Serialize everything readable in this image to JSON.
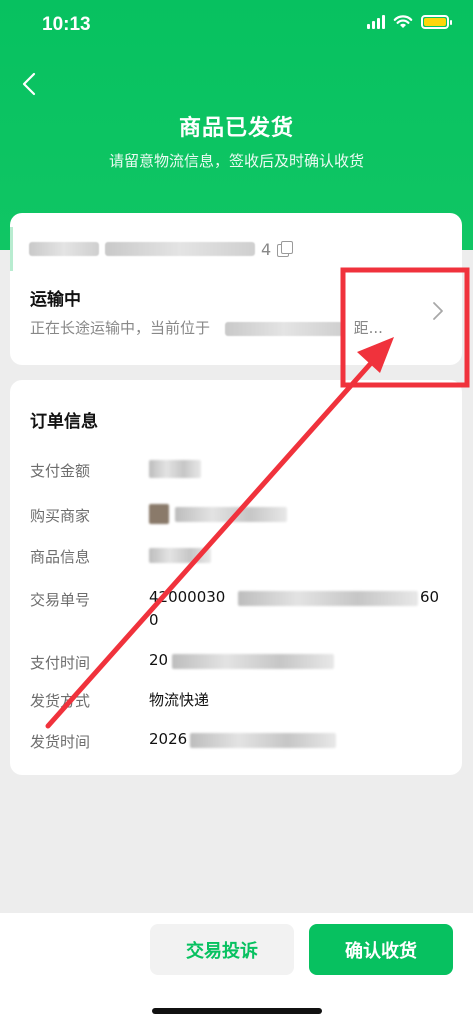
{
  "status_bar": {
    "time": "10:13"
  },
  "header": {
    "title": "商品已发货",
    "subtitle": "请留意物流信息，签收后及时确认收货"
  },
  "logistics": {
    "tracking_suffix": "4",
    "status": "运输中",
    "detail_prefix": "正在长途运输中，当前位于",
    "detail_suffix": "距..."
  },
  "order_info": {
    "title": "订单信息",
    "rows": [
      {
        "label": "支付金额",
        "value": ""
      },
      {
        "label": "购买商家",
        "value": ""
      },
      {
        "label": "商品信息",
        "value": ""
      },
      {
        "label": "交易单号",
        "value": "42000030",
        "value_end": "60",
        "value_line2": "0"
      },
      {
        "label": "支付时间",
        "value": "20"
      },
      {
        "label": "发货方式",
        "value": "物流快递"
      },
      {
        "label": "发货时间",
        "value": "2026"
      }
    ]
  },
  "actions": {
    "complain": "交易投诉",
    "confirm": "确认收货"
  },
  "colors": {
    "brand_green": "#07c160",
    "annotation_red": "#f0323c",
    "background": "#ededed"
  }
}
